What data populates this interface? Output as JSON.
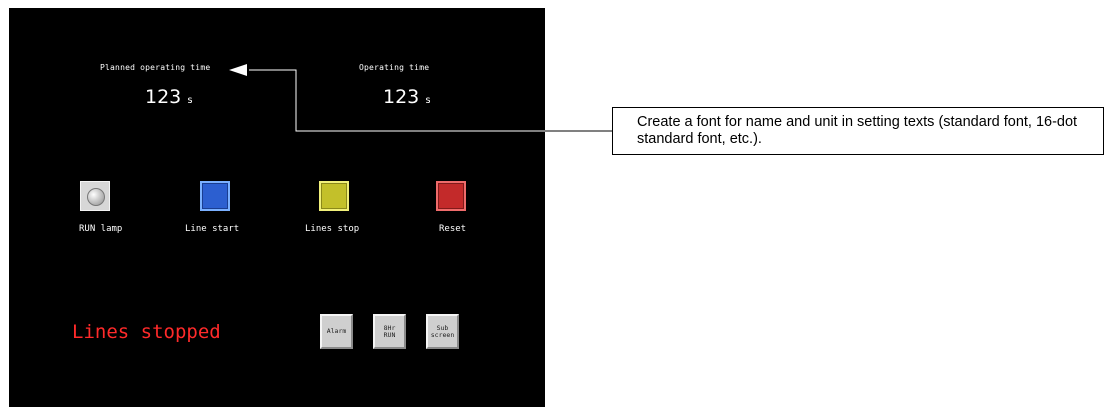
{
  "panel": {
    "planned": {
      "label": "Planned operating time",
      "value": "123",
      "unit": "s"
    },
    "operating": {
      "label": "Operating time",
      "value": "123",
      "unit": "s"
    },
    "tiles": {
      "run_lamp": "RUN lamp",
      "line_start": "Line start",
      "lines_stop": "Lines stop",
      "reset": "Reset"
    },
    "status_text": "Lines stopped",
    "softkeys": {
      "alarm": "Alarm",
      "run8hr": "8Hr\nRUN",
      "sub_screen": "Sub\nscreen"
    }
  },
  "annotation": {
    "text": "Create a font for name and unit in setting texts (standard font, 16-dot standard font, etc.)."
  },
  "colors": {
    "screen_bg": "#000000",
    "status_red": "#ff2a2a",
    "start_blue": "#2c5fd0",
    "stop_yellow": "#c3c02a",
    "reset_red": "#c32a2a"
  }
}
